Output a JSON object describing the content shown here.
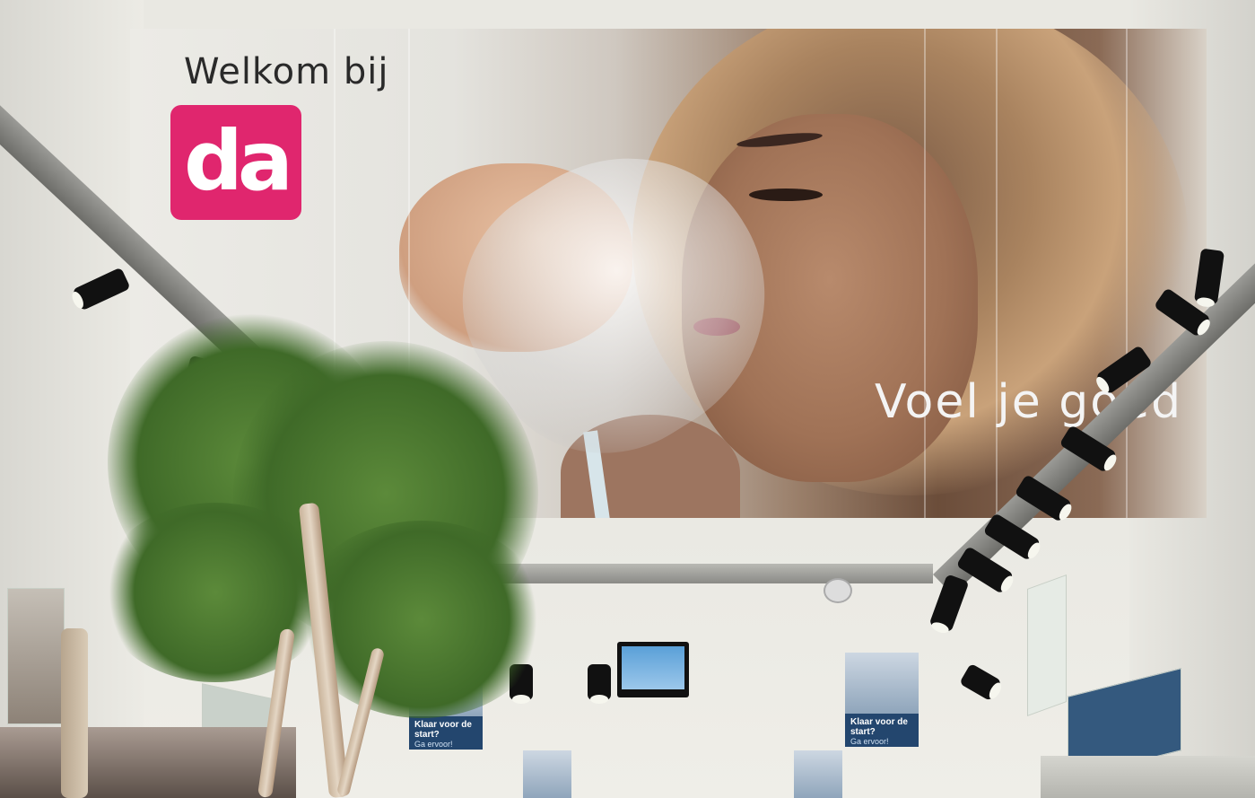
{
  "banner": {
    "welcome_text": "Welkom bij",
    "logo_text": "da",
    "tagline": "Voel je goed"
  },
  "posters": {
    "headline": "Klaar voor de start?",
    "subline": "Ga ervoor!"
  },
  "colors": {
    "logo_pink": "#e0266e",
    "poster_blue": "#23466e"
  }
}
